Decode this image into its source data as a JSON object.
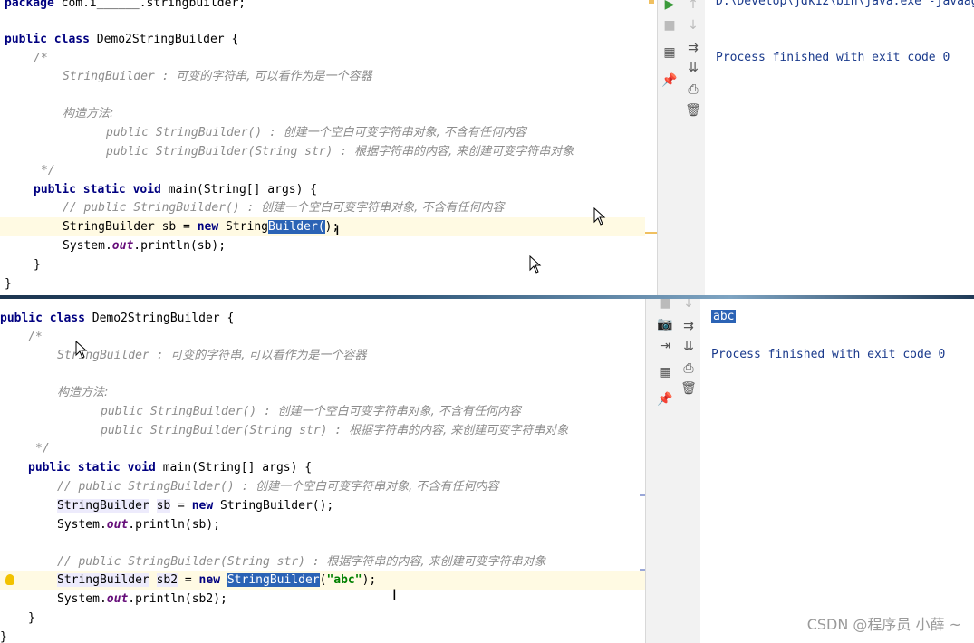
{
  "top": {
    "code": {
      "package_kw": "package",
      "package_rest": " com.i______.stringbuilder;",
      "class_kw": "public class",
      "class_name": " Demo2StringBuilder {",
      "comment_open": "/*",
      "c1_en": "StringBuilder : ",
      "c1_cn": "可变的字符串, 可以看作为是一个容器",
      "c2_cn": "构造方法:",
      "c3_en": "public StringBuilder() : ",
      "c3_cn": "创建一个空白可变字符串对象, 不含有任何内容",
      "c4_en": "public StringBuilder(String str) : ",
      "c4_cn": "根据字符串的内容, 来创建可变字符串对象",
      "comment_close": "*/",
      "main_kw": "public static void",
      "main_rest": " main(String[] args) {",
      "lc1_en": "// public StringBuilder() : ",
      "lc1_cn": "创建一个空白可变字符串对象, 不含有任何内容",
      "sb_type": "StringBuilder ",
      "sb_var": "sb",
      "sb_eq": " = ",
      "sb_new": "new",
      "sb_ctor_pre": " String",
      "sb_ctor_sel": "Builder(",
      "sb_ctor_post": ");",
      "print_pre": "System.",
      "print_out": "out",
      "print_post": ".println(sb);",
      "close_brace_inner": "}",
      "close_brace_outer": "}"
    },
    "console": {
      "command": "D:\\Develop\\jdk12\\bin\\java.exe -javaag",
      "finished": "Process finished with exit code 0"
    }
  },
  "bottom": {
    "code": {
      "class_kw": "public class",
      "class_name": " Demo2StringBuilder {",
      "comment_open": "/*",
      "c1_en": "StringBuilder : ",
      "c1_cn": "可变的字符串, 可以看作为是一个容器",
      "c2_cn": "构造方法:",
      "c3_en": "public StringBuilder() : ",
      "c3_cn": "创建一个空白可变字符串对象, 不含有任何内容",
      "c4_en": "public StringBuilder(String str) : ",
      "c4_cn": "根据字符串的内容, 来创建可变字符串对象",
      "comment_close": "*/",
      "main_kw": "public static void",
      "main_rest": " main(String[] args) {",
      "lc1_en": "// public StringBuilder() : ",
      "lc1_cn": "创建一个空白可变字符串对象, 不含有任何内容",
      "sb_type": "StringBuilder",
      "sb_var": "sb",
      "sb_eq": " = ",
      "sb_new": "new",
      "sb_ctor": " StringBuilder();",
      "print1_pre": "System.",
      "print_out": "out",
      "print1_post": ".println(sb);",
      "lc2_en": "// public StringBuilder(String str) : ",
      "lc2_cn": "根据字符串的内容, 来创建可变字符串对象",
      "sb2_type": "StringBuilder",
      "sb2_var": "sb2",
      "sb2_eq": " = ",
      "sb2_new": "new",
      "sb2_ctor_sel": "StringBuilder",
      "sb2_paren_open": "(",
      "sb2_arg": "\"abc\"",
      "sb2_paren_close": ");",
      "print2_pre": "System.",
      "print2_post": ".println(sb2);",
      "close_brace_inner": "}",
      "close_brace_outer": "}"
    },
    "console": {
      "output": "abc",
      "finished": "Process finished with exit code 0"
    }
  },
  "watermark": "CSDN @程序员 小薛 ~",
  "colors": {
    "keyword": "#000080",
    "comment": "#8c8c8c",
    "selection": "#2b63b5",
    "console_text": "#1a3a8c",
    "caret_row": "#fffae3"
  },
  "icons": [
    "run-icon",
    "stop-icon",
    "up-arrow-icon",
    "down-arrow-icon",
    "layout-icon",
    "soft-wrap-icon",
    "pin-icon",
    "scroll-end-icon",
    "print-icon",
    "trash-icon",
    "camera-icon",
    "login-icon",
    "lightbulb-icon"
  ]
}
